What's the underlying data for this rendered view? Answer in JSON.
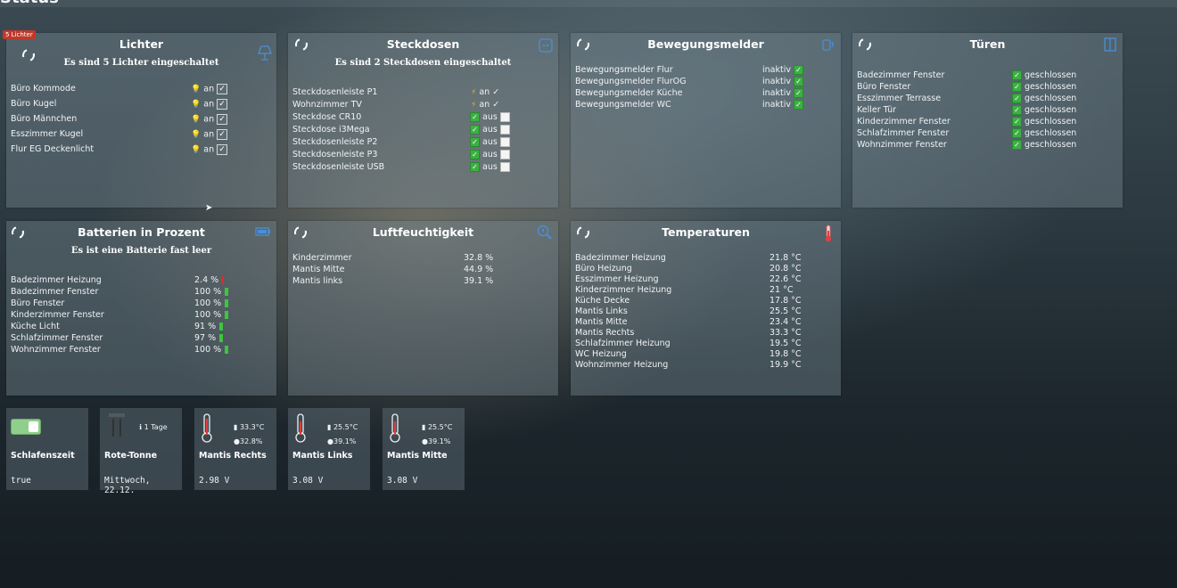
{
  "page_title": "Status",
  "lichter": {
    "badge": "5 Lichter",
    "title": "Lichter",
    "subtitle": "Es sind 5 Lichter eingeschaltet",
    "items": [
      {
        "name": "Büro Kommode",
        "state": "an"
      },
      {
        "name": "Büro Kugel",
        "state": "an"
      },
      {
        "name": "Büro Männchen",
        "state": "an"
      },
      {
        "name": "Esszimmer Kugel",
        "state": "an"
      },
      {
        "name": "Flur EG Deckenlicht",
        "state": "an"
      }
    ]
  },
  "steckdosen": {
    "title": "Steckdosen",
    "subtitle": "Es sind 2 Steckdosen eingeschaltet",
    "items": [
      {
        "name": "Steckdosenleiste P1",
        "state": "an"
      },
      {
        "name": "Wohnzimmer TV",
        "state": "an"
      },
      {
        "name": "Steckdose CR10",
        "state": "aus"
      },
      {
        "name": "Steckdose i3Mega",
        "state": "aus"
      },
      {
        "name": "Steckdosenleiste P2",
        "state": "aus"
      },
      {
        "name": "Steckdosenleiste P3",
        "state": "aus"
      },
      {
        "name": "Steckdosenleiste USB",
        "state": "aus"
      }
    ]
  },
  "bewegungsmelder": {
    "title": "Bewegungsmelder",
    "items": [
      {
        "name": "Bewegungsmelder Flur",
        "state": "inaktiv"
      },
      {
        "name": "Bewegungsmelder FlurOG",
        "state": "inaktiv"
      },
      {
        "name": "Bewegungsmelder Küche",
        "state": "inaktiv"
      },
      {
        "name": "Bewegungsmelder WC",
        "state": "inaktiv"
      }
    ]
  },
  "tueren": {
    "title": "Türen",
    "items": [
      {
        "name": "Badezimmer Fenster",
        "state": "geschlossen"
      },
      {
        "name": "Büro Fenster",
        "state": "geschlossen"
      },
      {
        "name": "Esszimmer Terrasse",
        "state": "geschlossen"
      },
      {
        "name": "Keller Tür",
        "state": "geschlossen"
      },
      {
        "name": "Kinderzimmer Fenster",
        "state": "geschlossen"
      },
      {
        "name": "Schlafzimmer Fenster",
        "state": "geschlossen"
      },
      {
        "name": "Wohnzimmer Fenster",
        "state": "geschlossen"
      }
    ]
  },
  "batterien": {
    "title": "Batterien in Prozent",
    "subtitle": "Es ist eine Batterie fast leer",
    "items": [
      {
        "name": "Badezimmer Heizung",
        "value": "2.4 %",
        "low": true
      },
      {
        "name": "Badezimmer Fenster",
        "value": "100 %",
        "low": false
      },
      {
        "name": "Büro Fenster",
        "value": "100 %",
        "low": false
      },
      {
        "name": "Kinderzimmer Fenster",
        "value": "100 %",
        "low": false
      },
      {
        "name": "Küche Licht",
        "value": "91 %",
        "low": false
      },
      {
        "name": "Schlafzimmer Fenster",
        "value": "97 %",
        "low": false
      },
      {
        "name": "Wohnzimmer Fenster",
        "value": "100 %",
        "low": false
      }
    ]
  },
  "luftfeuchtigkeit": {
    "title": "Luftfeuchtigkeit",
    "items": [
      {
        "name": "Kinderzimmer",
        "value": "32.8 %"
      },
      {
        "name": "Mantis Mitte",
        "value": "44.9 %"
      },
      {
        "name": "Mantis links",
        "value": "39.1 %"
      }
    ]
  },
  "temperaturen": {
    "title": "Temperaturen",
    "items": [
      {
        "name": "Badezimmer Heizung",
        "value": "21.8 °C"
      },
      {
        "name": "Büro Heizung",
        "value": "20.8 °C"
      },
      {
        "name": "Esszimmer Heizung",
        "value": "22.6 °C"
      },
      {
        "name": "Kinderzimmer Heizung",
        "value": "21 °C"
      },
      {
        "name": "Küche Decke",
        "value": "17.8 °C"
      },
      {
        "name": "Mantis Links",
        "value": "25.5 °C"
      },
      {
        "name": "Mantis Mitte",
        "value": "23.4 °C"
      },
      {
        "name": "Mantis Rechts",
        "value": "33.3 °C"
      },
      {
        "name": "Schlafzimmer Heizung",
        "value": "19.5 °C"
      },
      {
        "name": "WC Heizung",
        "value": "19.8 °C"
      },
      {
        "name": "Wohnzimmer Heizung",
        "value": "19.9 °C"
      }
    ]
  },
  "tiles": {
    "schlafenszeit": {
      "name": "Schlafenszeit",
      "value": "true"
    },
    "rote_tonne": {
      "name": "Rote-Tonne",
      "days": "1 Tage",
      "value": "Mittwoch, 22.12."
    },
    "mantis_rechts": {
      "name": "Mantis Rechts",
      "temp": "33.3°C",
      "hum": "32.8%",
      "value": "2.98 V"
    },
    "mantis_links": {
      "name": "Mantis Links",
      "temp": "25.5°C",
      "hum": "39.1%",
      "value": "3.08 V"
    },
    "mantis_mitte": {
      "name": "Mantis Mitte",
      "temp": "25.5°C",
      "hum": "39.1%",
      "value": "3.08 V"
    }
  },
  "colors": {
    "accent": "#4a8fd6",
    "ok": "#3cb043",
    "alert": "#c0392b",
    "bulb": "#f2c230"
  }
}
